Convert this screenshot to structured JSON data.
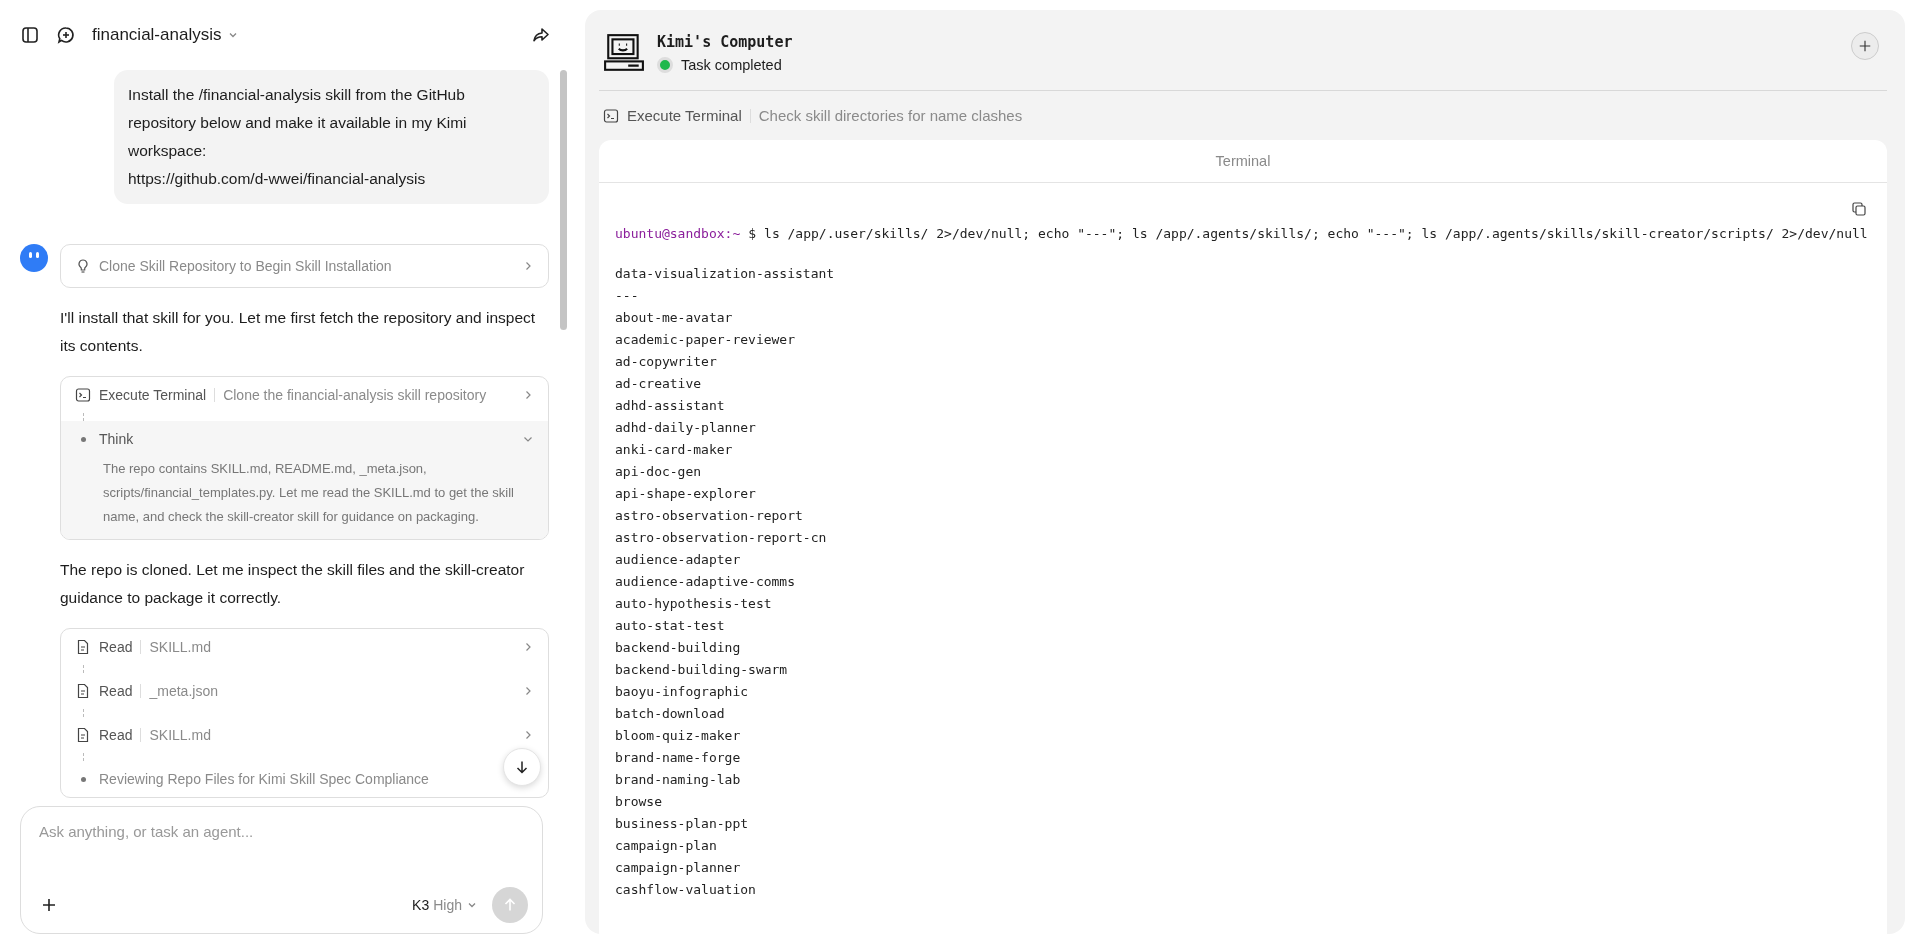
{
  "header": {
    "title": "financial-analysis"
  },
  "chat": {
    "user_message": {
      "text": "Install the /financial-analysis skill from the GitHub repository below and make it available in my Kimi workspace:",
      "url": "https://github.com/d-wwei/financial-analysis"
    },
    "assistant": [
      {
        "kind": "plan",
        "text": "Clone Skill Repository to Begin Skill Installation"
      },
      {
        "kind": "paragraph",
        "text": "I'll install that skill for you. Let me first fetch the repository and inspect its contents."
      },
      {
        "kind": "steps",
        "steps": [
          {
            "kind": "terminal",
            "action": "Execute Terminal",
            "detail": "Clone the financial-analysis skill repository"
          },
          {
            "kind": "think",
            "title": "Think",
            "expanded": true,
            "body": "The repo contains SKILL.md, README.md, _meta.json, scripts/financial_templates.py. Let me read the SKILL.md to get the skill name, and check the skill-creator skill for guidance on packaging."
          }
        ]
      },
      {
        "kind": "paragraph",
        "text": "The repo is cloned. Let me inspect the skill files and the skill-creator guidance to package it correctly."
      },
      {
        "kind": "steps",
        "steps": [
          {
            "kind": "read",
            "action": "Read",
            "detail": "SKILL.md"
          },
          {
            "kind": "read",
            "action": "Read",
            "detail": "_meta.json"
          },
          {
            "kind": "read",
            "action": "Read",
            "detail": "SKILL.md"
          },
          {
            "kind": "status",
            "title": "Reviewing Repo Files for Kimi Skill Spec Compliance"
          }
        ]
      }
    ]
  },
  "composer": {
    "placeholder": "Ask anything, or task an agent...",
    "model": "K3",
    "effort": "High",
    "send_disabled": true
  },
  "computer": {
    "title": "Kimi's Computer",
    "status": "Task completed",
    "done": true,
    "step": {
      "action": "Execute Terminal",
      "detail": "Check skill directories for name clashes"
    },
    "terminal": {
      "title": "Terminal",
      "prompt": "ubuntu@sandbox:~",
      "symbol": "$",
      "command": "ls /app/.user/skills/ 2>/dev/null; echo \"---\"; ls /app/.agents/skills/; echo \"---\"; ls /app/.agents/skills/skill-creator/scripts/ 2>/dev/null",
      "output": [
        "data-visualization-assistant",
        "---",
        "about-me-avatar",
        "academic-paper-reviewer",
        "ad-copywriter",
        "ad-creative",
        "adhd-assistant",
        "adhd-daily-planner",
        "anki-card-maker",
        "api-doc-gen",
        "api-shape-explorer",
        "astro-observation-report",
        "astro-observation-report-cn",
        "audience-adapter",
        "audience-adaptive-comms",
        "auto-hypothesis-test",
        "auto-stat-test",
        "backend-building",
        "backend-building-swarm",
        "baoyu-infographic",
        "batch-download",
        "bloom-quiz-maker",
        "brand-name-forge",
        "brand-naming-lab",
        "browse",
        "business-plan-ppt",
        "campaign-plan",
        "campaign-planner",
        "cashflow-valuation"
      ]
    }
  }
}
